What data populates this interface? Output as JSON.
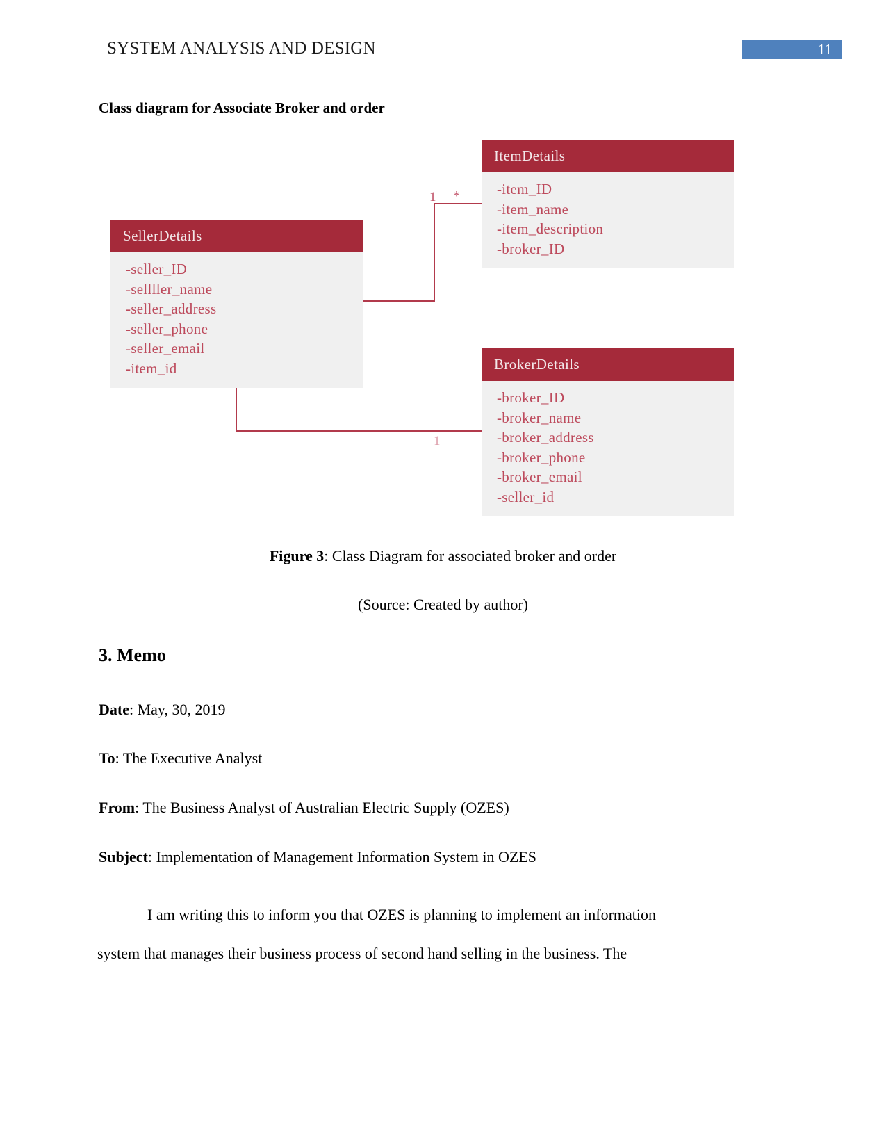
{
  "header": {
    "title": "SYSTEM ANALYSIS AND DESIGN",
    "page_number": "11",
    "badge_color": "#4f81bd"
  },
  "section": {
    "heading": "Class diagram for Associate Broker and order"
  },
  "diagram": {
    "title_color": "#a52a3a",
    "body_color": "#f0f0f0",
    "attribute_color": "#bd4a5c",
    "line_color": "#b23a4c",
    "classes": [
      {
        "id": "ItemDetails",
        "name": "ItemDetails",
        "attributes": [
          "-item_ID",
          "-item_name",
          "-item_description",
          "-broker_ID"
        ]
      },
      {
        "id": "SellerDetails",
        "name": "SellerDetails",
        "attributes": [
          "-seller_ID",
          "-sellller_name",
          "-seller_address",
          "-seller_phone",
          "-seller_email",
          "-item_id"
        ]
      },
      {
        "id": "BrokerDetails",
        "name": "BrokerDetails",
        "attributes": [
          "-broker_ID",
          "-broker_name",
          "-broker_address",
          "-broker_phone",
          "-broker_email",
          "-seller_id"
        ]
      }
    ],
    "associations": [
      {
        "from": "SellerDetails",
        "to": "ItemDetails",
        "source_multiplicity": "1",
        "target_multiplicity": "*"
      },
      {
        "from": "SellerDetails",
        "to": "BrokerDetails",
        "source_multiplicity": "1",
        "target_multiplicity": ""
      }
    ]
  },
  "captions": {
    "figure_label": "Figure 3",
    "figure_text": ": Class Diagram for associated broker and order",
    "source": "(Source: Created by author)"
  },
  "memo": {
    "heading": "3. Memo",
    "date_label": "Date",
    "date_value": ": May, 30, 2019",
    "to_label": "To",
    "to_value": ": The Executive Analyst",
    "from_label": "From",
    "from_value": ": The Business Analyst of Australian Electric Supply (OZES)",
    "subject_label": "Subject",
    "subject_value": ": Implementation of Management Information System in OZES",
    "body_paragraph_1": "I am writing this to inform you that OZES is planning to implement an information",
    "body_paragraph_2": "system that manages their business process of second hand selling in the business. The"
  }
}
